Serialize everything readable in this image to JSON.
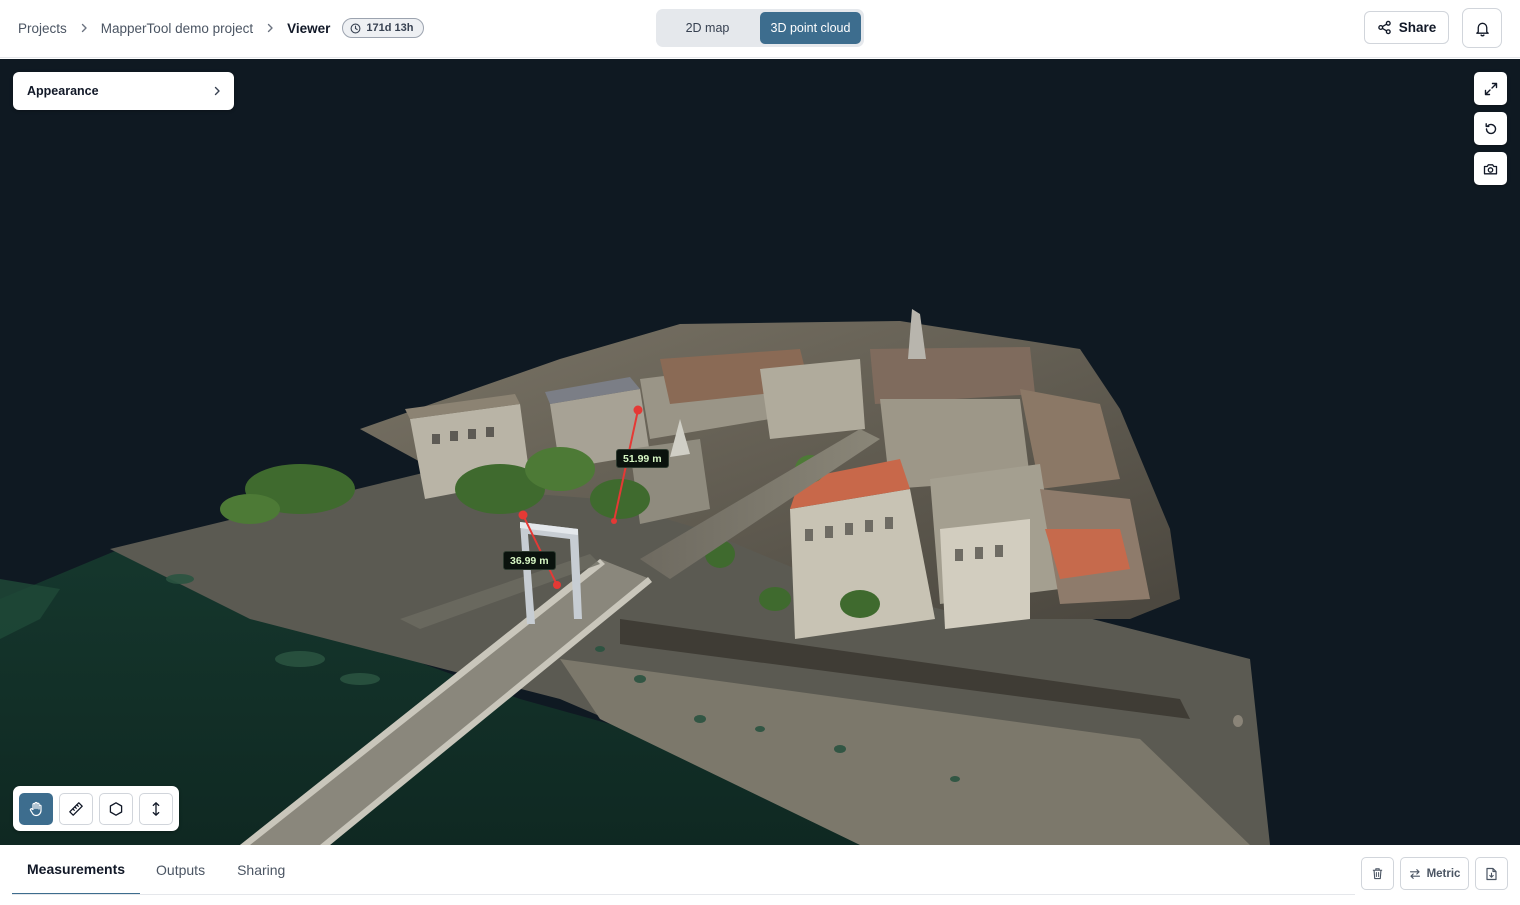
{
  "header": {
    "breadcrumb": [
      {
        "label": "Projects"
      },
      {
        "label": "MapperTool demo project"
      }
    ],
    "current_page": "Viewer",
    "timer": "171d 13h",
    "view_modes": [
      {
        "label": "2D map",
        "active": false
      },
      {
        "label": "3D point cloud",
        "active": true
      }
    ],
    "share_label": "Share"
  },
  "viewer": {
    "appearance_label": "Appearance",
    "right_tools": [
      "expand-icon",
      "reset-view-icon",
      "camera-icon"
    ],
    "tools": [
      {
        "icon": "hand-pan-icon",
        "active": true
      },
      {
        "icon": "ruler-icon",
        "active": false
      },
      {
        "icon": "polygon-icon",
        "active": false
      },
      {
        "icon": "vertical-height-icon",
        "active": false
      }
    ],
    "measurements": [
      {
        "label": "51.99 m"
      },
      {
        "label": "36.99 m"
      }
    ]
  },
  "bottom": {
    "tabs": [
      {
        "label": "Measurements",
        "active": true
      },
      {
        "label": "Outputs",
        "active": false
      },
      {
        "label": "Sharing",
        "active": false
      }
    ],
    "units_label": "Metric"
  },
  "colors": {
    "accent": "#3d6d8e",
    "viewer_background": "#0f1922",
    "measure_line": "#e53935"
  }
}
